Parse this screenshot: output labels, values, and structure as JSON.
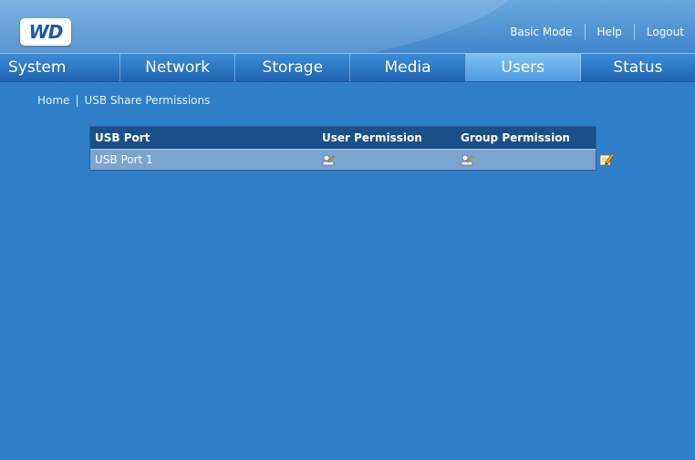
{
  "header": {
    "logo_text": "WD",
    "links": {
      "basic_mode": "Basic Mode",
      "help": "Help",
      "logout": "Logout"
    }
  },
  "nav": {
    "tabs": [
      {
        "label": "System"
      },
      {
        "label": "Network"
      },
      {
        "label": "Storage"
      },
      {
        "label": "Media"
      },
      {
        "label": "Users",
        "active": true
      },
      {
        "label": "Status"
      }
    ]
  },
  "breadcrumb": {
    "home": "Home",
    "separator": "|",
    "current": "USB Share Permissions"
  },
  "table": {
    "headers": [
      "USB Port",
      "User Permission",
      "Group Permission"
    ],
    "rows": [
      {
        "port": "USB Port 1",
        "user_icon": "user-permission-icon",
        "group_icon": "group-permission-icon"
      }
    ]
  },
  "icons": {
    "edit": "edit-icon"
  },
  "colors": {
    "background": "#2e7fc8",
    "nav_active": "#6db3ec",
    "table_header": "#1a4f88",
    "table_row": "#7ba4cf"
  }
}
